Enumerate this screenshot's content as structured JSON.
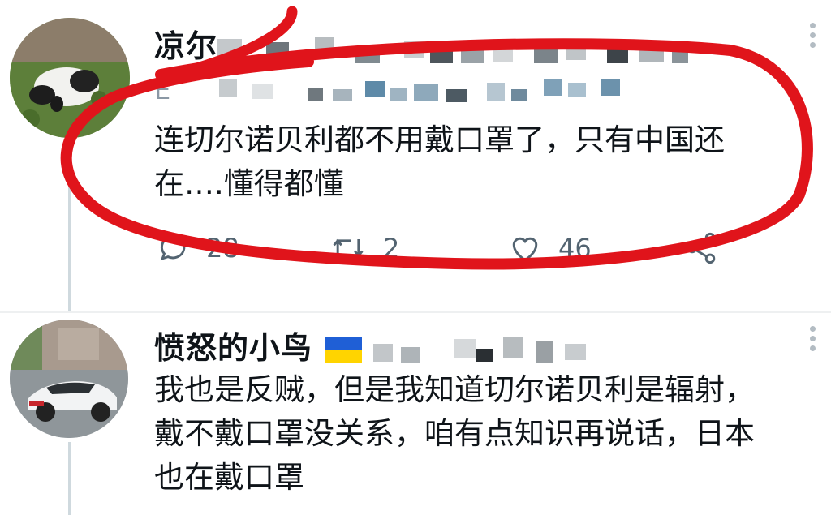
{
  "tweet1": {
    "author_name": "凉尔",
    "handle": "E",
    "text_line1": "连切尔诺贝利都不用戴口罩了，只有中国还",
    "text_line2": "在….懂得都懂",
    "replies": "28",
    "retweets": "2",
    "likes": "46"
  },
  "tweet2": {
    "author_name": "愤怒的小鸟",
    "text_line1": "我也是反贼，但是我知道切尔诺贝利是辐射，",
    "text_line2": "戴不戴口罩没关系，咱有点知识再说话，日本",
    "text_line3": "也在戴口罩"
  },
  "colors": {
    "annotation_red": "#e0141b",
    "flag_blue": "#1f5fd6",
    "flag_yellow": "#ffd400",
    "muted_text": "#536471"
  },
  "icons": {
    "reply": "reply-icon",
    "retweet": "retweet-icon",
    "like": "heart-icon",
    "share": "share-icon",
    "more": "more-vertical-icon"
  }
}
